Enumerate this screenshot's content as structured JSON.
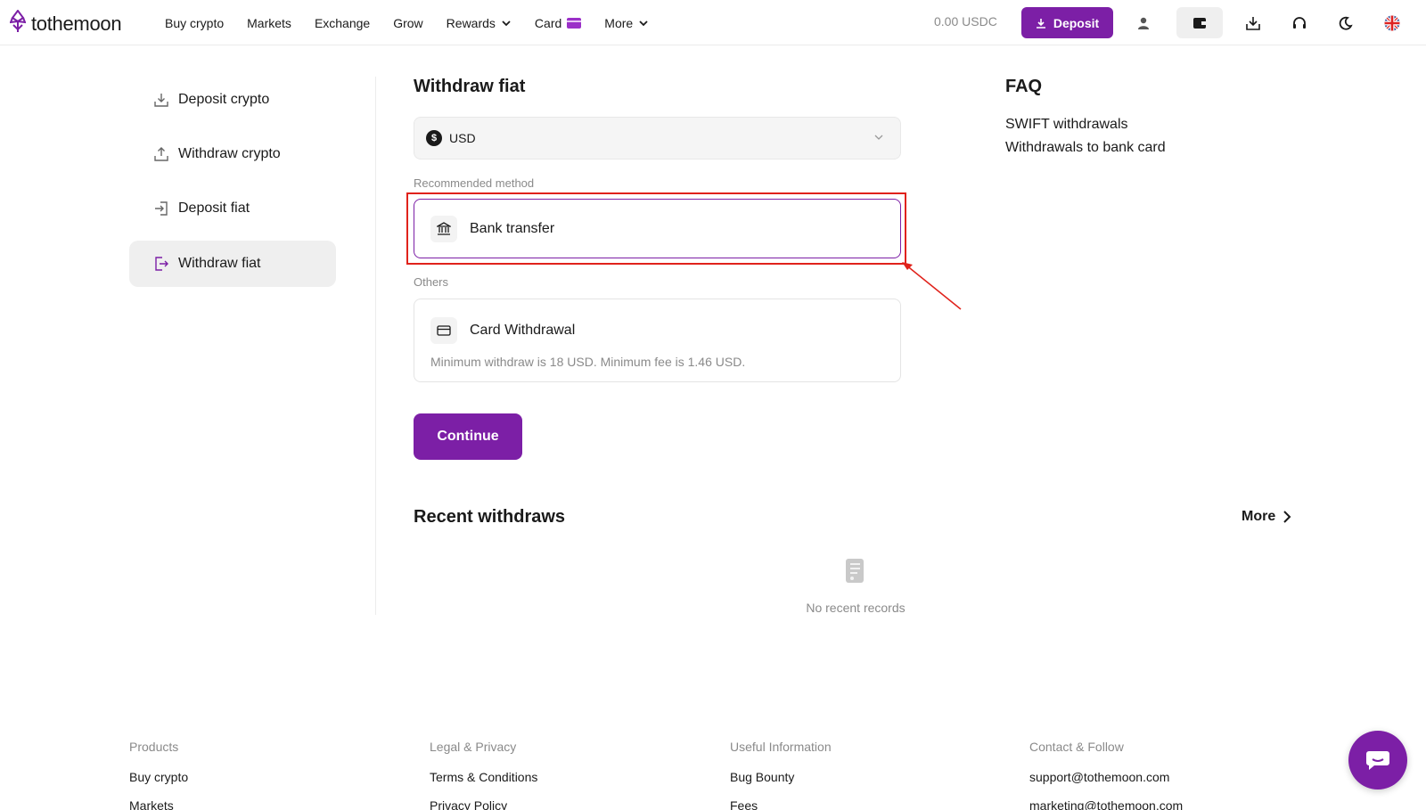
{
  "brand": {
    "name": "tothemoon",
    "accent_color": "#7c1fa6"
  },
  "nav": {
    "items": [
      {
        "label": "Buy crypto"
      },
      {
        "label": "Markets"
      },
      {
        "label": "Exchange"
      },
      {
        "label": "Grow"
      },
      {
        "label": "Rewards",
        "dropdown": true
      },
      {
        "label": "Card",
        "icon": "card-icon"
      },
      {
        "label": "More",
        "dropdown": true
      }
    ]
  },
  "header": {
    "balance": "0.00 USDC",
    "deposit_label": "Deposit",
    "icons": [
      "user-icon",
      "wallet-icon",
      "download-icon",
      "headset-icon",
      "moon-icon",
      "uk-flag-icon"
    ]
  },
  "sidebar": {
    "items": [
      {
        "label": "Deposit crypto",
        "icon": "download-icon"
      },
      {
        "label": "Withdraw crypto",
        "icon": "upload-icon"
      },
      {
        "label": "Deposit fiat",
        "icon": "login-icon"
      },
      {
        "label": "Withdraw fiat",
        "icon": "logout-icon",
        "active": true
      }
    ]
  },
  "withdraw": {
    "title": "Withdraw fiat",
    "currency": {
      "symbol": "$",
      "code": "USD"
    },
    "recommended_label": "Recommended method",
    "recommended": {
      "label": "Bank transfer",
      "icon": "bank-icon"
    },
    "others_label": "Others",
    "others": [
      {
        "label": "Card Withdrawal",
        "icon": "credit-card-icon",
        "note": "Minimum withdraw is 18 USD. Minimum fee is 1.46 USD."
      }
    ],
    "continue_label": "Continue"
  },
  "recent": {
    "title": "Recent withdraws",
    "more_label": "More",
    "empty_text": "No recent records"
  },
  "faq": {
    "title": "FAQ",
    "links": [
      "SWIFT withdrawals",
      "Withdrawals to bank card"
    ]
  },
  "footer": {
    "columns": [
      {
        "heading": "Products",
        "links": [
          "Buy crypto",
          "Markets"
        ]
      },
      {
        "heading": "Legal & Privacy",
        "links": [
          "Terms & Conditions",
          "Privacy Policy"
        ]
      },
      {
        "heading": "Useful Information",
        "links": [
          "Bug Bounty",
          "Fees"
        ]
      },
      {
        "heading": "Contact & Follow",
        "links": [
          "support@tothemoon.com",
          "marketing@tothemoon.com"
        ]
      }
    ]
  }
}
